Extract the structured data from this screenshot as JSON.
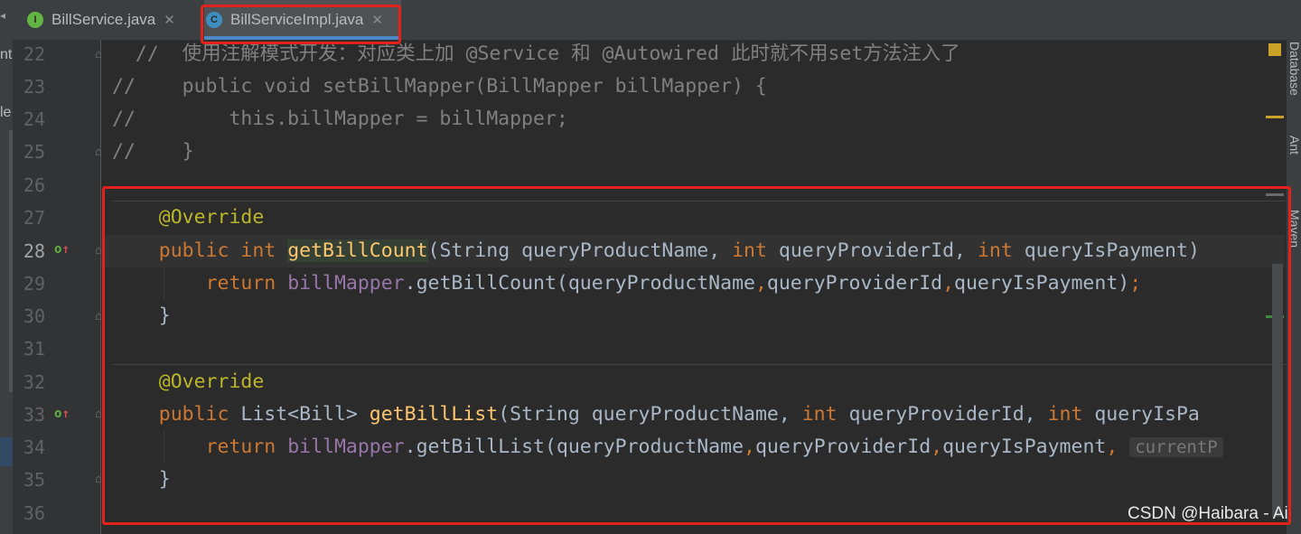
{
  "tabs": [
    {
      "label": "BillService.java",
      "icon_letter": "I",
      "icon": "interface-icon",
      "active": false
    },
    {
      "label": "BillServiceImpl.java",
      "icon_letter": "C",
      "icon": "class-icon",
      "active": true
    }
  ],
  "left_panel": {
    "fragment_1": "ntr",
    "fragment_2": "le"
  },
  "right_tools": [
    "Database",
    "Ant",
    "Maven"
  ],
  "line_numbers": [
    "22",
    "23",
    "24",
    "25",
    "26",
    "27",
    "28",
    "29",
    "30",
    "31",
    "32",
    "33",
    "34",
    "35",
    "36"
  ],
  "current_line": "28",
  "code": {
    "l22": "//  使用注解模式开发：对应类上加 @Service 和 @Autowired 此时就不用set方法注入了",
    "l23": "//    public void setBillMapper(BillMapper billMapper) {",
    "l24": "//        this.billMapper = billMapper;",
    "l25": "//    }",
    "l27_ann": "@Override",
    "l28_kw1": "public",
    "l28_kw2": "int",
    "l28_fn": "getBillCount",
    "l28_p1": "(String queryProductName, ",
    "l28_kw3": "int",
    "l28_p2": " queryProviderId, ",
    "l28_kw4": "int",
    "l28_p3": " queryIsPayment)",
    "l29_kw": "return",
    "l29_fld": "billMapper",
    "l29_rest": ".getBillCount(queryProductName",
    "l29_rest2": "queryProviderId",
    "l29_rest3": "queryIsPayment)",
    "l30": "}",
    "l32_ann": "@Override",
    "l33_kw1": "public",
    "l33_type": " List<Bill> ",
    "l33_fn": "getBillList",
    "l33_p1": "(String queryProductName, ",
    "l33_kw2": "int",
    "l33_p2": " queryProviderId, ",
    "l33_kw3": "int",
    "l33_p3": " queryIsPa",
    "l34_kw": "return",
    "l34_fld": "billMapper",
    "l34_rest": ".getBillList(queryProductName",
    "l34_rest2": "queryProviderId",
    "l34_rest3": "queryIsPayment",
    "l34_hint": "currentP",
    "l35": "}"
  },
  "watermark": "CSDN @Haibara - Ai",
  "colors": {
    "keyword": "#cc7832",
    "annotation": "#bbb529",
    "method": "#ffc66d",
    "field": "#9876aa",
    "comment": "#808080",
    "highlight_box": "#e3231b"
  }
}
